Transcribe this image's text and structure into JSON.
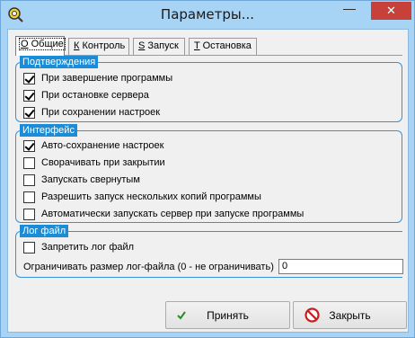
{
  "window": {
    "title": "Параметры...",
    "minimize_glyph": "—",
    "close_glyph": "✕"
  },
  "tabs": [
    {
      "hotkey": "О",
      "rest": " Общие",
      "active": true
    },
    {
      "hotkey": "К",
      "rest": " Контроль",
      "active": false
    },
    {
      "hotkey": "S",
      "rest": " Запуск",
      "active": false
    },
    {
      "hotkey": "T",
      "rest": " Остановка",
      "active": false
    }
  ],
  "confirmations": {
    "title": "Подтверждения",
    "items": [
      {
        "label": "При завершение программы",
        "checked": true
      },
      {
        "label": "При остановке сервера",
        "checked": true
      },
      {
        "label": "При сохранении настроек",
        "checked": true
      }
    ]
  },
  "interface": {
    "title": "Интерфейс",
    "items": [
      {
        "label": "Авто-сохранение настроек",
        "checked": true
      },
      {
        "label": "Сворачивать при закрытии",
        "checked": false
      },
      {
        "label": "Запускать свернутым",
        "checked": false
      },
      {
        "label": "Разрешить запуск нескольких копий программы",
        "checked": false
      },
      {
        "label": "Автоматически запускать сервер при запуске программы",
        "checked": false
      }
    ]
  },
  "log": {
    "title": "Лог файл",
    "disable_label": "Запретить лог файл",
    "disable_checked": false,
    "limit_label": "Ограничивать размер лог-файла (0 - не ограничивать)",
    "limit_value": "0"
  },
  "buttons": {
    "apply": "Принять",
    "close": "Закрыть"
  },
  "icons": {
    "app": "app-icon",
    "apply": "checkmark-icon",
    "close": "no-entry-icon"
  },
  "colors": {
    "titlebar": "#a7d3f5",
    "group_title_bg": "#1a8cd8",
    "close_button": "#c7403a"
  }
}
